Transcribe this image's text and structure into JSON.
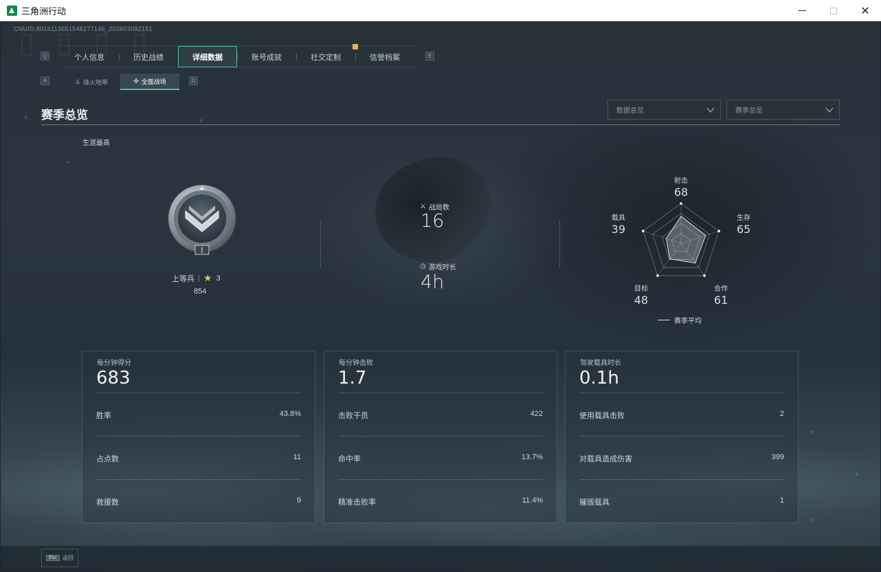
{
  "window": {
    "title": "三角洲行动"
  },
  "header": {
    "cnuid": "CNUID:8016113651548277146_202603092151",
    "tab_prev_key": "Q",
    "tab_next_key": "E",
    "tabs": [
      {
        "label": "个人信息"
      },
      {
        "label": "历史战绩"
      },
      {
        "label": "详细数据"
      },
      {
        "label": "账号成就"
      },
      {
        "label": "社交定制"
      },
      {
        "label": "信誉档案"
      }
    ],
    "active_tab": "详细数据",
    "subtab_prev_key": "A",
    "subtab_next_key": "D",
    "subtabs": [
      {
        "label": "烽火地带"
      },
      {
        "label": "全面战场"
      }
    ],
    "active_subtab": "全面战场"
  },
  "overview": {
    "title": "赛季总览",
    "dropdown_data": "数据总览",
    "dropdown_season": "赛季总览",
    "career_label": "生涯最高",
    "rank": {
      "name": "上等兵",
      "numeral": "I",
      "stars": "3",
      "points": "854"
    },
    "matches_label": "战局数",
    "matches_value": "16",
    "playtime_label": "游戏时长",
    "playtime_value": "4h"
  },
  "radar": {
    "axes": [
      {
        "label": "射击",
        "value": 68
      },
      {
        "label": "生存",
        "value": 65
      },
      {
        "label": "合作",
        "value": 61
      },
      {
        "label": "目标",
        "value": 48
      },
      {
        "label": "载具",
        "value": 39
      }
    ],
    "max": 100,
    "legend": "赛季平均"
  },
  "panels": [
    {
      "title": "每分钟得分",
      "value": "683",
      "rows": [
        {
          "label": "胜率",
          "value": "43.8%"
        },
        {
          "label": "占点数",
          "value": "11"
        },
        {
          "label": "救援数",
          "value": "9"
        }
      ]
    },
    {
      "title": "每分钟击败",
      "value": "1.7",
      "rows": [
        {
          "label": "击败干员",
          "value": "422"
        },
        {
          "label": "命中率",
          "value": "13.7%"
        },
        {
          "label": "精准击败率",
          "value": "11.4%"
        }
      ]
    },
    {
      "title": "驾驶载具时长",
      "value": "0.1h",
      "rows": [
        {
          "label": "使用载具击败",
          "value": "2"
        },
        {
          "label": "对载具造成伤害",
          "value": "399"
        },
        {
          "label": "摧毁载具",
          "value": "1"
        }
      ]
    }
  ],
  "footer": {
    "esc_key": "Esc",
    "back_label": "返回"
  },
  "colors": {
    "accent": "#48c1a2",
    "star": "#e6c25a",
    "notification": "#e6b73e"
  }
}
